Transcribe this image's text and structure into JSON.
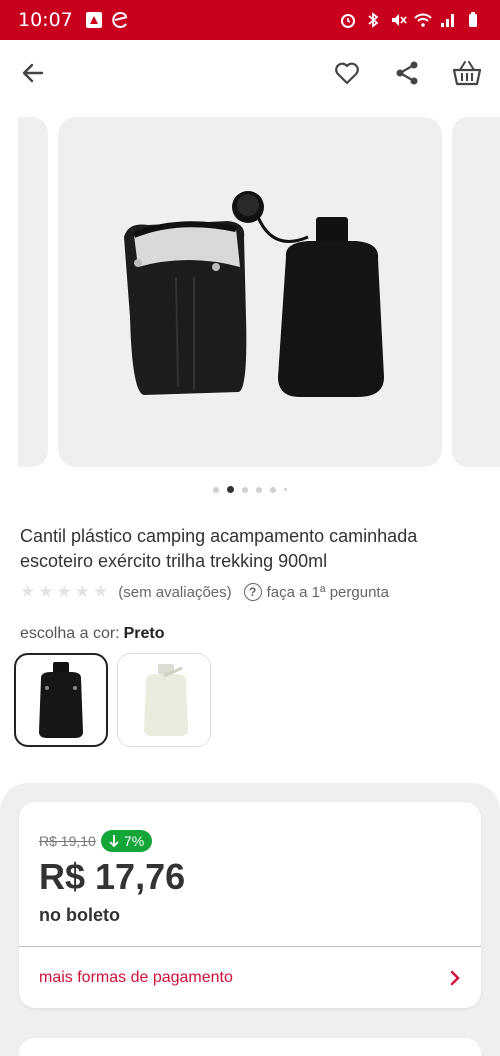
{
  "status_bar": {
    "time": "10:07"
  },
  "top_bar": {
    "back_icon": "arrow-left-icon",
    "actions": [
      "heart-icon",
      "share-icon",
      "basket-icon"
    ]
  },
  "carousel": {
    "slide_count": 6,
    "active_index": 1
  },
  "product": {
    "title": "Cantil plástico camping acampamento caminhada escoteiro exército trilha trekking 900ml",
    "rating_text": "(sem avaliações)",
    "question_text": "faça a 1ª pergunta",
    "star_count": 5
  },
  "color_selector": {
    "label": "escolha a cor:",
    "selected": "Preto",
    "options": [
      "Preto",
      "Branco"
    ]
  },
  "price": {
    "old_price": "R$ 19,10",
    "discount": "7%",
    "current_price": "R$ 17,76",
    "payment_note": "no boleto",
    "more_payments_label": "mais formas de pagamento"
  },
  "colors": {
    "brand": "#c8001e",
    "discount_green": "#13a538",
    "link_red": "#d0103a"
  }
}
